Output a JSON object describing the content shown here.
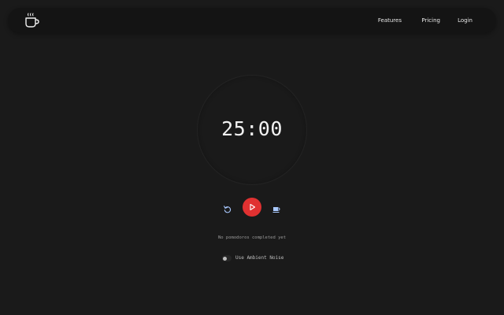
{
  "nav": {
    "links": [
      "Features",
      "Pricing",
      "Login"
    ]
  },
  "icons": {
    "logo": "coffee-cup-icon",
    "reset": "reset-icon",
    "play": "play-icon",
    "break": "coffee-break-icon"
  },
  "timer": {
    "display": "25:00"
  },
  "status": {
    "text": "No pomodoros completed yet"
  },
  "ambient": {
    "label": "Use Ambient Noise",
    "enabled": false
  },
  "colors": {
    "background": "#1a1a1a",
    "navbar": "#141414",
    "accent": "#e03131",
    "control_icons": "#a9c9ff"
  }
}
